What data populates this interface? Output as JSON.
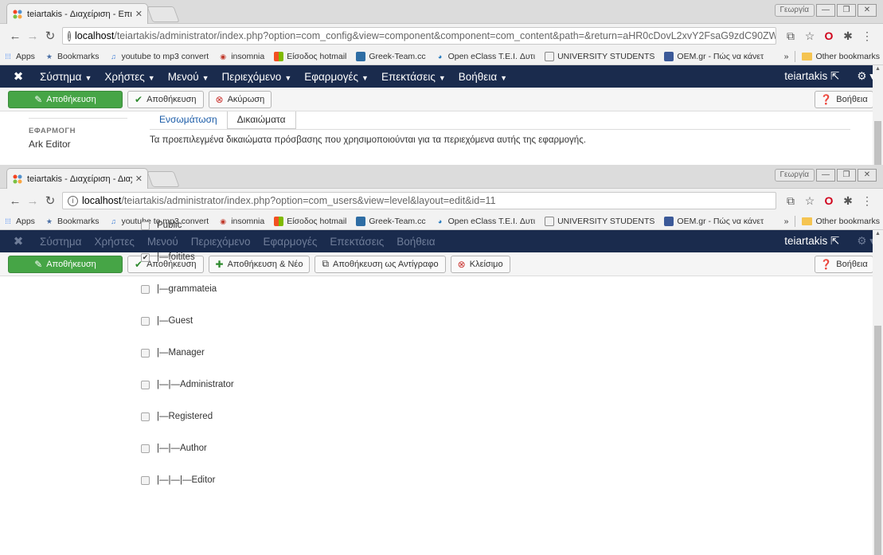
{
  "window1": {
    "tab_title": "teiartakis - Διαχείριση - Επι",
    "url_host": "localhost",
    "url_path": "/teiartakis/administrator/index.php?option=com_config&view=component&component=com_content&path=&return=aHR0cDovL2xvY2FsaG9zdC90ZWlhcnRha2lz",
    "profile_label": "Γεωργία",
    "toolbar": {
      "save_primary": "Αποθήκευση",
      "save": "Αποθήκευση",
      "cancel": "Ακύρωση",
      "help": "Βοήθεια"
    },
    "tabs": [
      "Ενσωμάτωση",
      "Δικαιώματα"
    ],
    "sidebar_heading": "ΕΦΑΡΜΟΓΗ",
    "sidebar_link": "Ark Editor",
    "description": "Τα προεπιλεγμένα δικαιώματα πρόσβασης που χρησιμοποιούνται για τα περιεχόμενα αυτής της εφαρμογής."
  },
  "window2": {
    "tab_title": "teiartakis - Διαχείριση - Διαχ",
    "url_host": "localhost",
    "url_path": "/teiartakis/administrator/index.php?option=com_users&view=level&layout=edit&id=11",
    "profile_label": "Γεωργία",
    "toolbar": {
      "save_primary": "Αποθήκευση",
      "save": "Αποθήκευση",
      "save_new": "Αποθήκευση & Νέο",
      "save_copy": "Αποθήκευση ως Αντίγραφο",
      "close": "Κλείσιμο",
      "help": "Βοήθεια"
    },
    "groups": [
      {
        "label": "Public",
        "checked": false
      },
      {
        "label": "|—foitites",
        "checked": true
      },
      {
        "label": "|—grammateia",
        "checked": false
      },
      {
        "label": "|—Guest",
        "checked": false
      },
      {
        "label": "|—Manager",
        "checked": false
      },
      {
        "label": "|—|—Administrator",
        "checked": false
      },
      {
        "label": "|—Registered",
        "checked": false
      },
      {
        "label": "|—|—Author",
        "checked": false
      },
      {
        "label": "|—|—|—Editor",
        "checked": false
      }
    ]
  },
  "bookmarks": {
    "apps": "Apps",
    "items": [
      "Bookmarks",
      "youtube to mp3 convert",
      "insomnia",
      "Είσοδος hotmail",
      "Greek-Team.cc",
      "Open eClass T.E.I. Δυτι",
      "UNIVERSITY STUDENTS",
      "OEM.gr - Πώς να κάνετ"
    ],
    "overflow": "»",
    "other": "Other bookmarks"
  },
  "joomla_menu": {
    "items": [
      "Σύστημα",
      "Χρήστες",
      "Μενού",
      "Περιεχόμενο",
      "Εφαρμογές",
      "Επεκτάσεις",
      "Βοήθεια"
    ],
    "user": "teiartakis"
  },
  "colors": {
    "navbar": "#1a2b4d",
    "save_green": "#46a546",
    "link_blue": "#1b5ca8"
  }
}
